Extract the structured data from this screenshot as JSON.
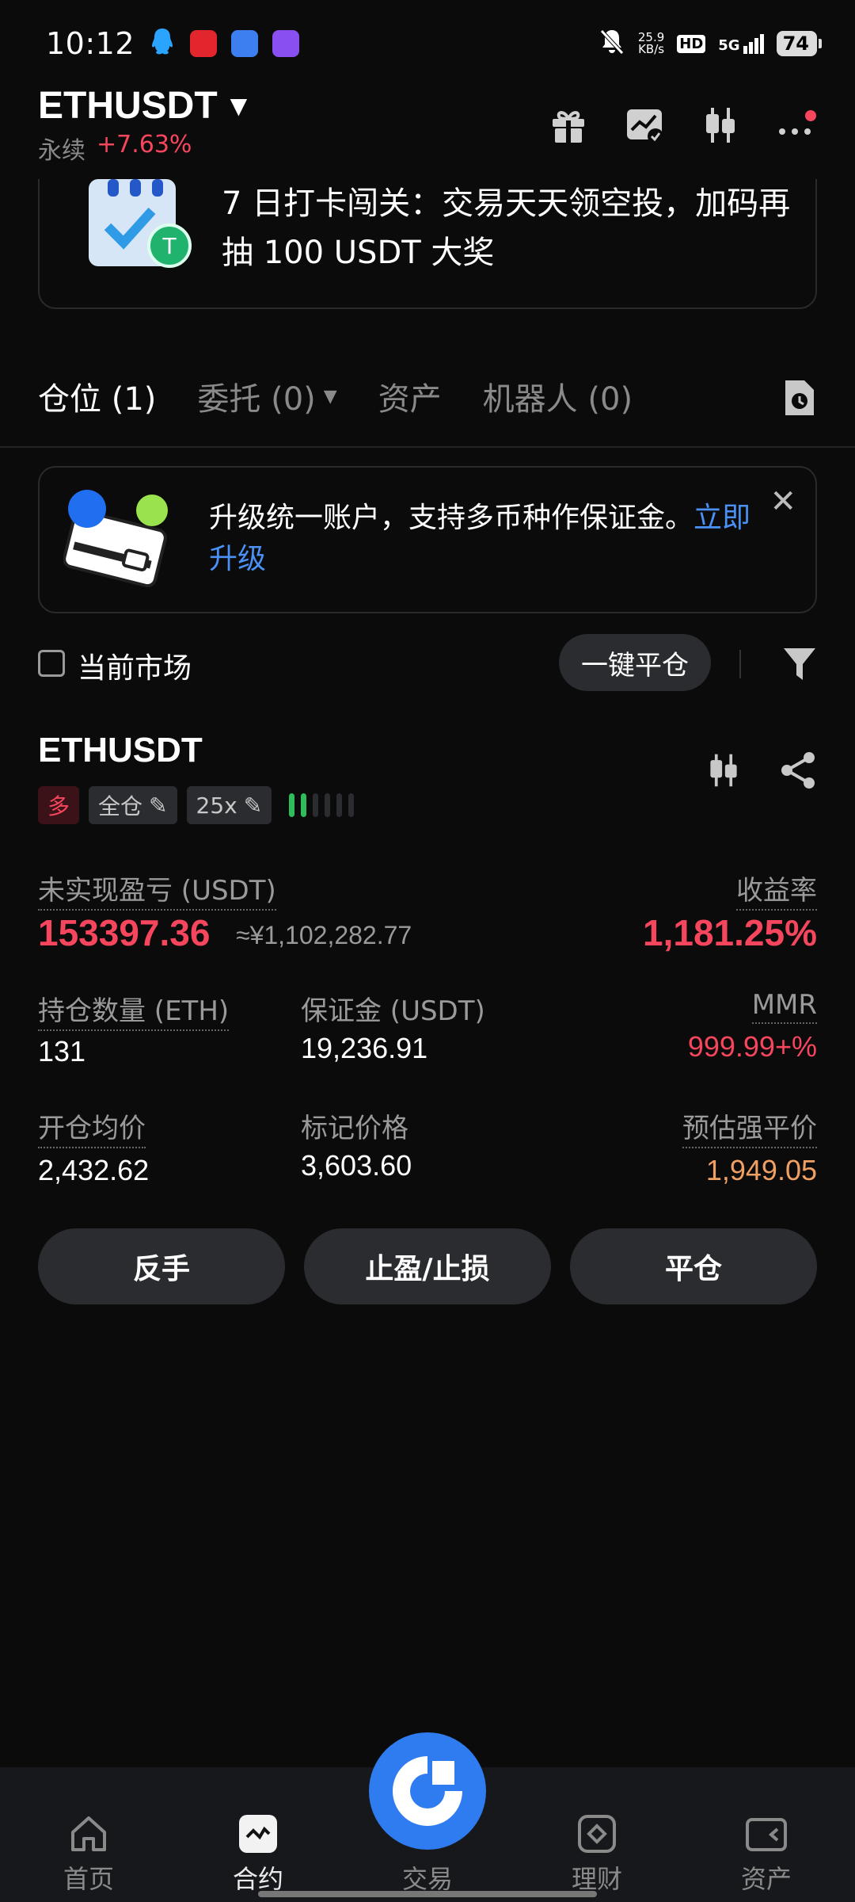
{
  "status_bar": {
    "time": "10:12",
    "net_speed_value": "25.9",
    "net_speed_unit": "KB/s",
    "network": "5G",
    "hd": "HD",
    "battery": "74",
    "icons": [
      "qq-icon",
      "taobao-icon",
      "shield-app-icon",
      "infinity-app-icon",
      "mute-bell-icon",
      "signal-icon"
    ]
  },
  "header": {
    "symbol": "ETHUSDT",
    "contract_type": "永续",
    "change": "+7.63%",
    "icons": [
      "gift-icon",
      "chart-check-icon",
      "candlestick-icon",
      "more-icon"
    ],
    "colors": {
      "up": "#2ebd5a",
      "down": "#f6465d",
      "accent": "#2f7bf0"
    }
  },
  "promo": {
    "text": "7 日打卡闯关：交易天天领空投，加码再抽 100 USDT 大奖"
  },
  "tabs": {
    "positions": "仓位 (1)",
    "orders": "委托 (0)",
    "assets": "资产",
    "bots": "机器人 (0)"
  },
  "upgrade_card": {
    "text": "升级统一账户，支持多币种作保证金。",
    "link": "立即升级"
  },
  "filter": {
    "current_market": "当前市场",
    "close_all": "一键平仓"
  },
  "position": {
    "symbol": "ETHUSDT",
    "side": "多",
    "margin_mode": "全仓",
    "leverage": "25x",
    "risk_level": "2/6",
    "unrealized_pnl_label": "未实现盈亏 (USDT)",
    "unrealized_pnl": "153397.36",
    "unrealized_pnl_cny": "≈¥1,102,282.77",
    "roe_label": "收益率",
    "roe": "1,181.25%",
    "size_label": "持仓数量 (ETH)",
    "size": "131",
    "margin_label": "保证金 (USDT)",
    "margin": "19,236.91",
    "mmr_label": "MMR",
    "mmr": "999.99+%",
    "entry_label": "开仓均价",
    "entry": "2,432.62",
    "mark_label": "标记价格",
    "mark": "3,603.60",
    "liq_label": "预估强平价",
    "liq": "1,949.05",
    "actions": {
      "reverse": "反手",
      "tpsl": "止盈/止损",
      "close": "平仓"
    }
  },
  "bottom_nav": {
    "home": "首页",
    "futures": "合约",
    "trade": "交易",
    "earn": "理财",
    "assets": "资产"
  }
}
